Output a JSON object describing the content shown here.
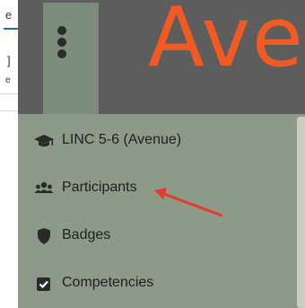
{
  "app": {
    "brand_text": "Ave",
    "colors": {
      "brand": "#f15a22",
      "header": "#5d5d5d",
      "drawer": "#8d9a8a",
      "annotation_arrow": "#e53b2a"
    }
  },
  "page_edge": {
    "fragments": [
      "e",
      "]",
      "e"
    ]
  },
  "header": {
    "menu_button_icon": "kebab-menu-icon"
  },
  "drawer": {
    "items": [
      {
        "label": "LINC 5-6 (Avenue)",
        "icon": "graduation-cap-icon"
      },
      {
        "label": "Participants",
        "icon": "users-icon"
      },
      {
        "label": "Badges",
        "icon": "shield-icon"
      },
      {
        "label": "Competencies",
        "icon": "checkbox-icon"
      }
    ]
  },
  "annotation": {
    "type": "arrow",
    "points_to": "Participants",
    "color": "#e53b2a"
  }
}
